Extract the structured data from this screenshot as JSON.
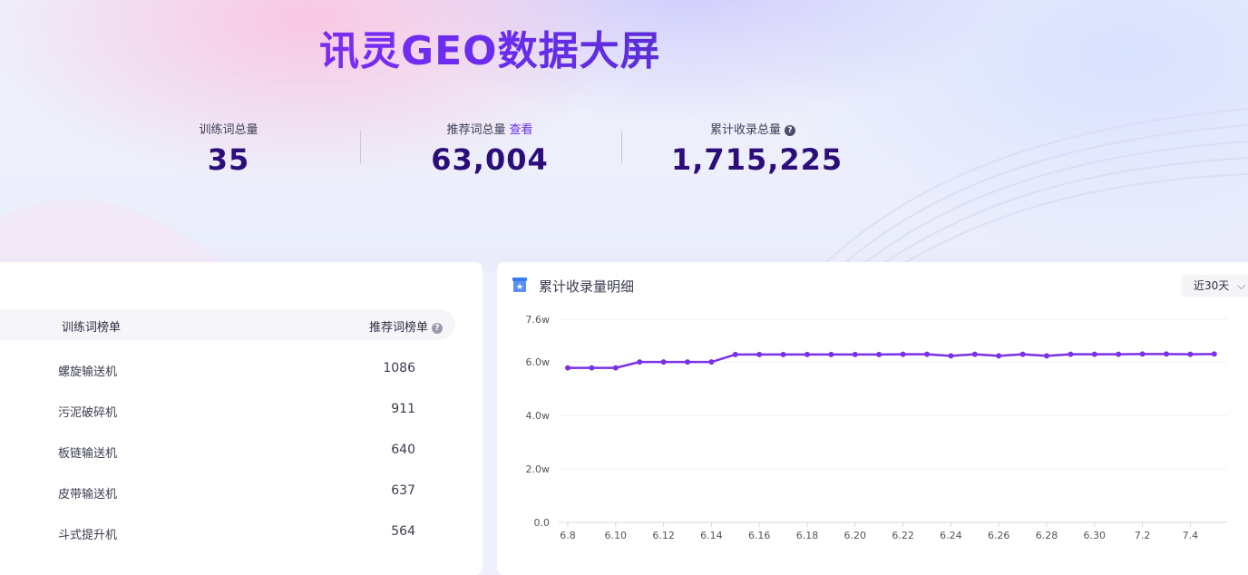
{
  "header": {
    "title": "讯灵GEO数据大屏",
    "stats": [
      {
        "label": "训练词总量",
        "value": "35"
      },
      {
        "label": "推荐词总量",
        "link": "查看",
        "value": "63,004"
      },
      {
        "label": "累计收录总量",
        "value": "1,715,225",
        "help": "?"
      }
    ]
  },
  "ranking": {
    "col_train": "训练词榜单",
    "col_recommend": "推荐词榜单",
    "help": "?",
    "rows": [
      {
        "name": "螺旋输送机",
        "value": "1086"
      },
      {
        "name": "污泥破碎机",
        "value": "911"
      },
      {
        "name": "板链输送机",
        "value": "640"
      },
      {
        "name": "皮带输送机",
        "value": "637"
      },
      {
        "name": "斗式提升机",
        "value": "564"
      }
    ]
  },
  "detail": {
    "title": "累计收录量明细",
    "range": "近30天",
    "icon": "archive-star-icon",
    "chev": "chevron-down-icon"
  },
  "colors": {
    "accent": "#7b2cf3",
    "line": "#7a32e6",
    "value_text": "#2b0e7a"
  },
  "chart_data": {
    "type": "line",
    "title": "",
    "xlabel": "",
    "ylabel": "",
    "ylim": [
      0,
      76000
    ],
    "y_ticks": [
      0,
      20000,
      40000,
      60000,
      76000
    ],
    "y_tick_labels": [
      "0.0",
      "2.0w",
      "4.0w",
      "6.0w",
      "7.6w"
    ],
    "x": [
      "6.8",
      "6.9",
      "6.10",
      "6.11",
      "6.12",
      "6.13",
      "6.14",
      "6.15",
      "6.16",
      "6.17",
      "6.18",
      "6.19",
      "6.20",
      "6.21",
      "6.22",
      "6.23",
      "6.24",
      "6.25",
      "6.26",
      "6.27",
      "6.28",
      "6.29",
      "6.30",
      "7.1",
      "7.2",
      "7.3",
      "7.4",
      "7.5"
    ],
    "x_tick_labels": [
      "6.8",
      "6.10",
      "6.12",
      "6.14",
      "6.16",
      "6.18",
      "6.20",
      "6.22",
      "6.24",
      "6.26",
      "6.28",
      "6.30",
      "7.2",
      "7.4"
    ],
    "grid": true,
    "series": [
      {
        "values": [
          57800,
          57800,
          57800,
          60000,
          60000,
          60000,
          60000,
          62800,
          62800,
          62800,
          62800,
          62800,
          62800,
          62800,
          62900,
          62900,
          62300,
          62900,
          62300,
          62900,
          62300,
          62900,
          62900,
          62900,
          63000,
          63000,
          62900,
          63000
        ]
      }
    ]
  }
}
